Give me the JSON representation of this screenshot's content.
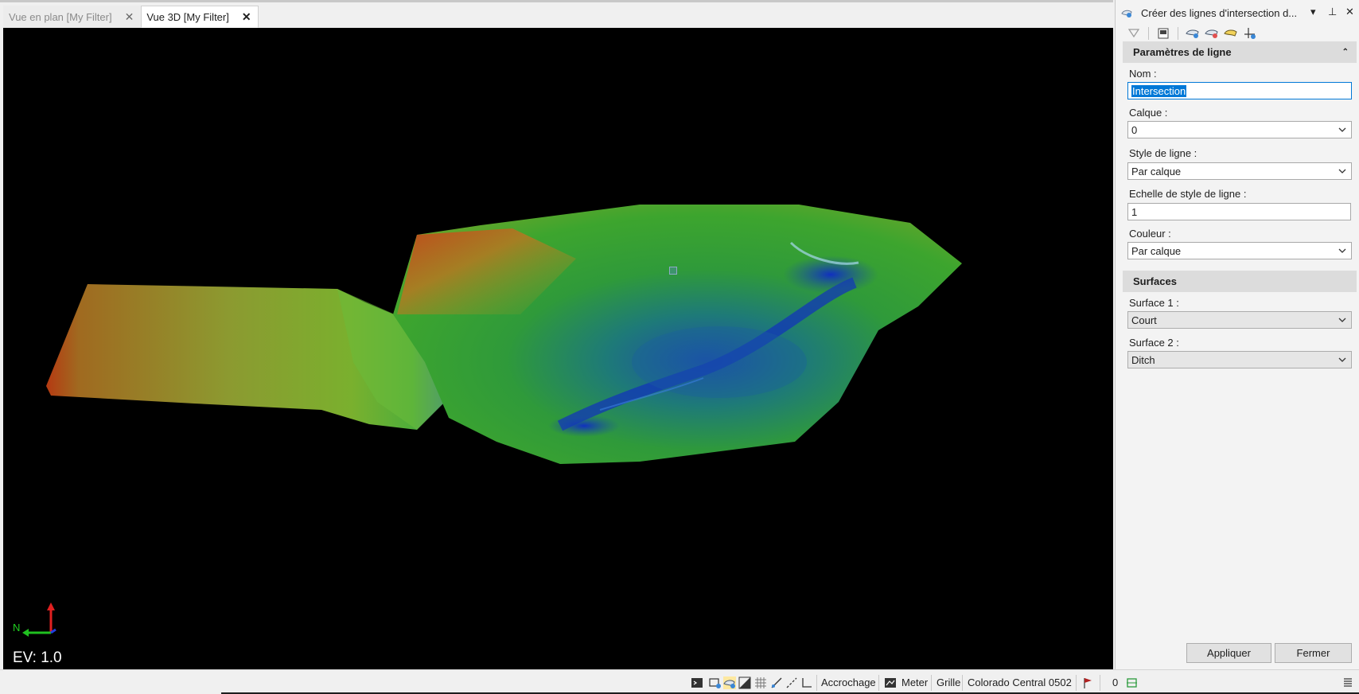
{
  "tabs": [
    {
      "label": "Vue en plan [My Filter]",
      "active": false
    },
    {
      "label": "Vue 3D [My Filter]",
      "active": true
    }
  ],
  "viewport": {
    "exaggeration_label": "EV: 1.0",
    "axis_north_label": "N",
    "background": "#000000"
  },
  "panel": {
    "title": "Créer des lignes d'intersection d...",
    "controls": {
      "dropdown_icon": "▾",
      "pin_icon": "⊥",
      "close_icon": "✕"
    },
    "sections": {
      "line_params": {
        "title": "Paramètres de ligne",
        "name_label": "Nom :",
        "name_value": "Intersection",
        "layer_label": "Calque :",
        "layer_value": "0",
        "linestyle_label": "Style de ligne :",
        "linestyle_value": "Par calque",
        "linescale_label": "Echelle de style de ligne :",
        "linescale_value": "1",
        "color_label": "Couleur :",
        "color_value": "Par calque"
      },
      "surfaces": {
        "title": "Surfaces",
        "surface1_label": "Surface 1 :",
        "surface1_value": "Court",
        "surface2_label": "Surface 2 :",
        "surface2_value": "Ditch"
      }
    },
    "buttons": {
      "apply": "Appliquer",
      "close": "Fermer"
    }
  },
  "statusbar": {
    "snap_label": "Accrochage",
    "units_label": "Meter",
    "grid_label": "Grille",
    "coord_system": "Colorado Central 0502",
    "count": "0"
  },
  "colors": {
    "accent": "#0078d7",
    "section_header": "#dcdcdc",
    "panel_bg": "#f3f3f3"
  }
}
